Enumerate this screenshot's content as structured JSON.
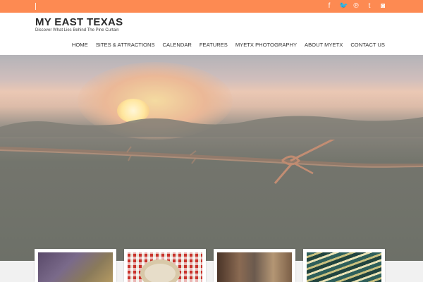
{
  "colors": {
    "accent": "#fd8a52"
  },
  "site": {
    "title": "MY EAST TEXAS",
    "tagline": "Discover What Lies Behind The Pine Curtain"
  },
  "social": [
    {
      "icon": "facebook-icon",
      "glyph": "f"
    },
    {
      "icon": "twitter-icon",
      "glyph": "🐦"
    },
    {
      "icon": "pinterest-icon",
      "glyph": "℗"
    },
    {
      "icon": "tumblr-icon",
      "glyph": "t"
    },
    {
      "icon": "instagram-icon",
      "glyph": "◙"
    }
  ],
  "nav": [
    "HOME",
    "SITES & ATTRACTIONS",
    "CALENDAR",
    "FEATURES",
    "MYETX PHOTOGRAPHY",
    "ABOUT MYETX",
    "CONTACT US"
  ],
  "cards": [
    {
      "name": "featured-card-1"
    },
    {
      "name": "featured-card-2"
    },
    {
      "name": "featured-card-3"
    },
    {
      "name": "featured-card-4"
    }
  ]
}
